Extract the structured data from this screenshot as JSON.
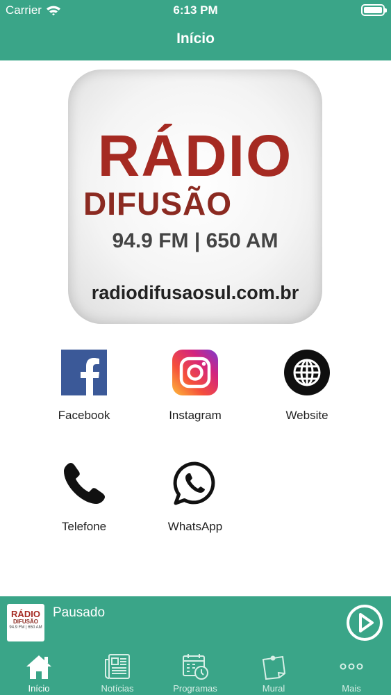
{
  "status_bar": {
    "carrier": "Carrier",
    "time": "6:13 PM"
  },
  "header": {
    "title": "Início"
  },
  "logo": {
    "line1": "RÁDIO",
    "line2": "DIFUSÃO",
    "line3": "94.9 FM | 650 AM",
    "line4": "radiodifusaosul.com.br"
  },
  "links": [
    {
      "label": "Facebook",
      "icon": "facebook-icon"
    },
    {
      "label": "Instagram",
      "icon": "instagram-icon"
    },
    {
      "label": "Website",
      "icon": "globe-icon"
    },
    {
      "label": "Telefone",
      "icon": "phone-icon"
    },
    {
      "label": "WhatsApp",
      "icon": "whatsapp-icon"
    }
  ],
  "player": {
    "state": "Pausado",
    "thumb_line1": "RÁDIO",
    "thumb_line2": "DIFUSÃO",
    "thumb_line3": "94.9 FM | 650 AM"
  },
  "tabs": [
    {
      "label": "Início",
      "icon": "home-icon",
      "active": true
    },
    {
      "label": "Notícias",
      "icon": "newspaper-icon"
    },
    {
      "label": "Programas",
      "icon": "calendar-clock-icon"
    },
    {
      "label": "Mural",
      "icon": "note-icon"
    },
    {
      "label": "Mais",
      "icon": "more-icon"
    }
  ],
  "colors": {
    "accent": "#3aa588",
    "brand_red": "#a52a22"
  }
}
